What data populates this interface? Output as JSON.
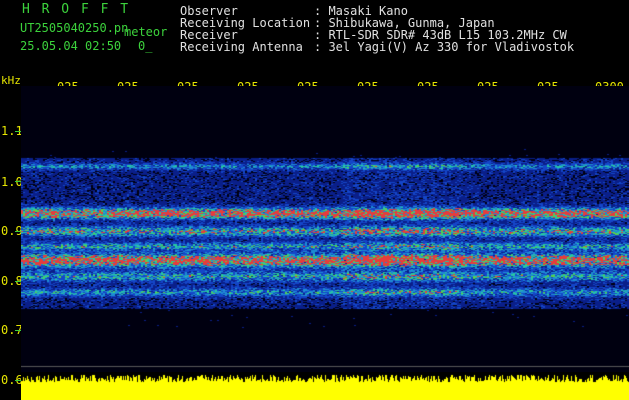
{
  "header": {
    "app_name": "H R O F F T",
    "filename": "UT2505040250.pn",
    "meteor_label": "meteor",
    "datetime": "25.05.04 02:50",
    "count": "0_"
  },
  "info": {
    "labels": [
      "Observer",
      "Receiving Location",
      "Receiver",
      "Receiving Antenna"
    ],
    "values": [
      ": Masaki Kano",
      ": Shibukawa, Gunma, Japan",
      ": RTL-SDR SDR# 43dB L15 103.2MHz CW",
      ": 3el Yagi(V) Az 330 for Vladivostok"
    ]
  },
  "time_axis": {
    "labels": [
      "025",
      "025",
      "025",
      "025",
      "025",
      "025",
      "025",
      "025",
      "025",
      "0300"
    ]
  },
  "freq_axis": {
    "unit": "kHz",
    "labels": [
      "1.1",
      "1.0",
      "0.9",
      "0.8",
      "0.7",
      "0.6"
    ]
  },
  "colors": {
    "header_green": "#3cd23c",
    "axis_yellow": "#e6e600",
    "amplitude_yellow": "#ffff00",
    "info_text": "#e0e0e0",
    "background": "#000000"
  }
}
